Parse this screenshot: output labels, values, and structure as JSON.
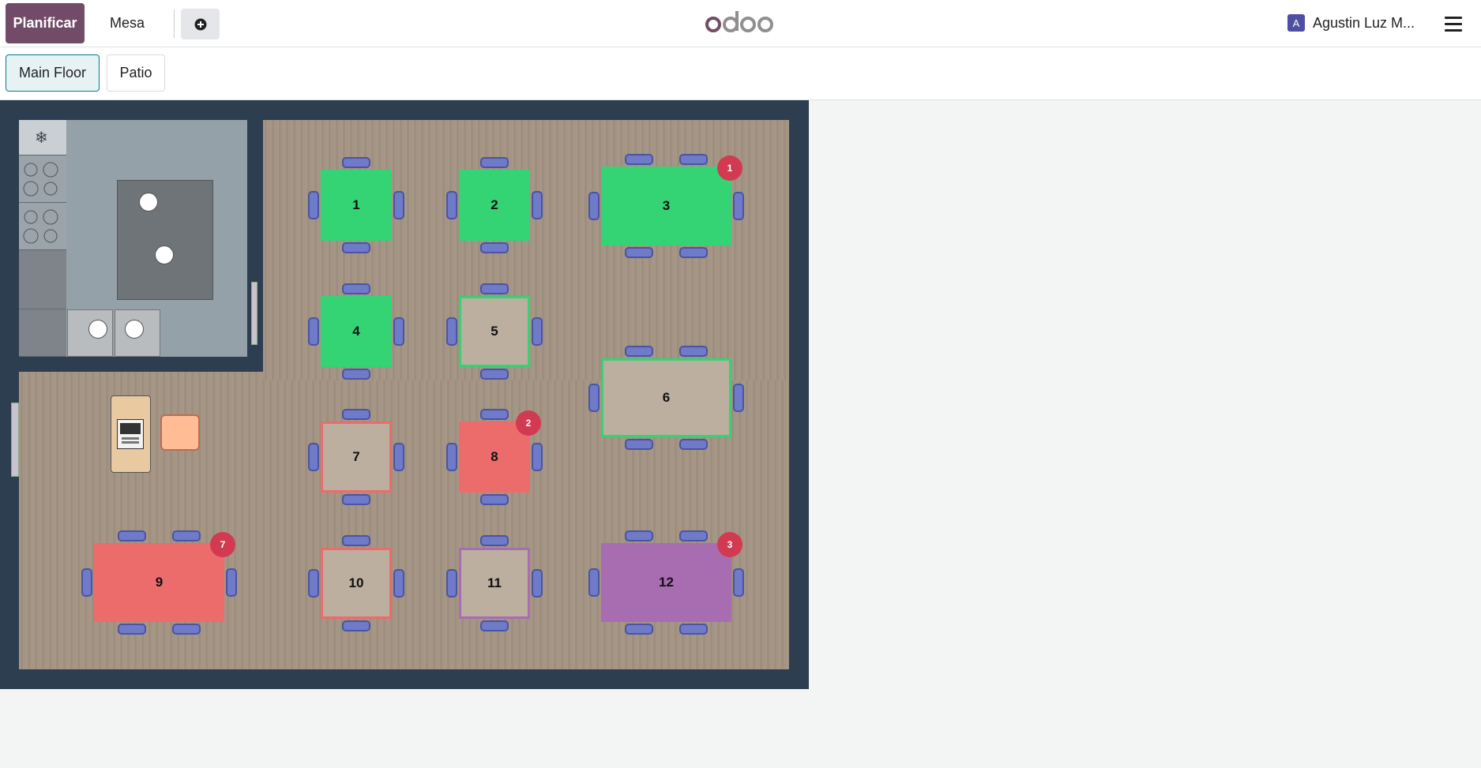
{
  "topbar": {
    "plan_label": "Planificar",
    "mesa_label": "Mesa",
    "brand": "odoo",
    "user_initial": "A",
    "user_name": "Agustin Luz M..."
  },
  "floors": [
    {
      "label": "Main Floor",
      "active": true
    },
    {
      "label": "Patio",
      "active": false
    }
  ],
  "colors": {
    "brand": "#714b67",
    "free": "#34d374",
    "occupied": "#ec6b6b",
    "reserved": "#a86db0",
    "empty": "#bcaf9f",
    "badge": "#d23a52"
  },
  "tables": [
    {
      "label": "1",
      "state": "free"
    },
    {
      "label": "2",
      "state": "free"
    },
    {
      "label": "3",
      "state": "free",
      "badge": "1"
    },
    {
      "label": "4",
      "state": "free"
    },
    {
      "label": "5",
      "state": "empty-green"
    },
    {
      "label": "6",
      "state": "empty-green"
    },
    {
      "label": "7",
      "state": "empty-red"
    },
    {
      "label": "8",
      "state": "occupied",
      "badge": "2"
    },
    {
      "label": "9",
      "state": "occupied",
      "badge": "7"
    },
    {
      "label": "10",
      "state": "empty-red"
    },
    {
      "label": "11",
      "state": "empty-purple"
    },
    {
      "label": "12",
      "state": "reserved",
      "badge": "3"
    }
  ]
}
